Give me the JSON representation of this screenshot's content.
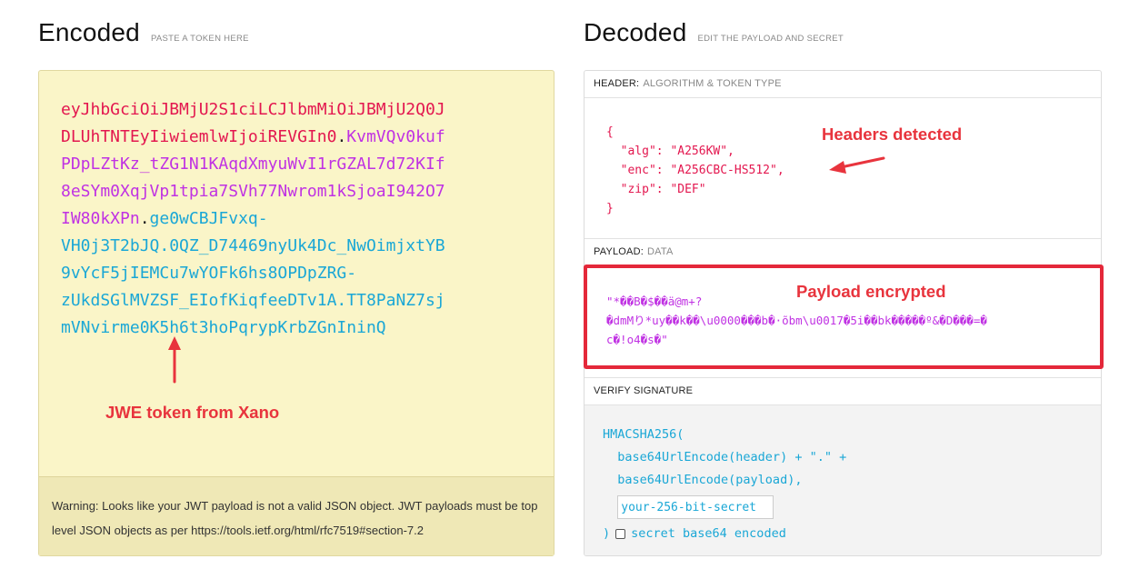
{
  "encoded": {
    "title": "Encoded",
    "subtitle": "PASTE A TOKEN HERE",
    "token_lines": [
      [
        {
          "t": "eyJhbGciOiJBMjU2S1ciLCJlbmMiOiJBMjU2Q0J",
          "c": "head"
        }
      ],
      [
        {
          "t": "DLUhTNTEyIiwiemlwIjoiREVGIn0",
          "c": "head"
        },
        {
          "t": ".",
          "c": "dot"
        },
        {
          "t": "KvmVQv0kuf",
          "c": "key"
        }
      ],
      [
        {
          "t": "PDpLZtKz_tZG1N1KAqdXmyuWvI1rGZAL7d72KIf",
          "c": "key"
        }
      ],
      [
        {
          "t": "8eSYm0XqjVp1tpia7SVh77Nwrom1kSjoaI942O7",
          "c": "key"
        }
      ],
      [
        {
          "t": "IW80kXPn",
          "c": "key"
        },
        {
          "t": ".",
          "c": "dot"
        },
        {
          "t": "ge0wCBJFvxq-",
          "c": "iv"
        }
      ],
      [
        {
          "t": "VH0j3T2bJQ.0QZ_D74469nyUk4Dc_NwOimjxtYB",
          "c": "iv"
        }
      ],
      [
        {
          "t": "9vYcF5jIEMCu7wYOFk6hs8OPDpZRG-",
          "c": "iv"
        }
      ],
      [
        {
          "t": "zUkdSGlMVZSF_EIofKiqfeeDTv1A.TT8PaNZ7sj",
          "c": "iv"
        }
      ],
      [
        {
          "t": "mVNvirme0K5h6t3hoPqrypKrbZGnIninQ",
          "c": "iv"
        }
      ]
    ],
    "warning_label": "Warning:",
    "warning_text": " Looks like your JWT payload is not a valid JSON object. JWT payloads must be top level JSON objects as per https://tools.ietf.org/html/rfc7519#section-7.2"
  },
  "decoded": {
    "title": "Decoded",
    "subtitle": "EDIT THE PAYLOAD AND SECRET",
    "header_label": "HEADER:",
    "header_sub": "ALGORITHM & TOKEN TYPE",
    "header_json": "{\n  \"alg\": \"A256KW\",\n  \"enc\": \"A256CBC-HS512\",\n  \"zip\": \"DEF\"\n}",
    "payload_label": "PAYLOAD:",
    "payload_sub": "DATA",
    "payload_text": "\"*��B�$��ä@m+?\n�dmMり*uy��k��\\u0000���b�·õbm\\u0017�5i��bk�����º&�D���=�\nc�!o4�s�\"",
    "verify_label": "VERIFY SIGNATURE",
    "verify_line1": "HMACSHA256(",
    "verify_line2": "  base64UrlEncode(header) + \".\" +",
    "verify_line3": "  base64UrlEncode(payload),",
    "secret_placeholder": "your-256-bit-secret",
    "verify_close": ")",
    "base64_label": "secret base64 encoded"
  },
  "annotations": {
    "headers": "Headers detected",
    "payload": "Payload encrypted",
    "token": "JWE token from Xano",
    "color": "#e8343d"
  }
}
